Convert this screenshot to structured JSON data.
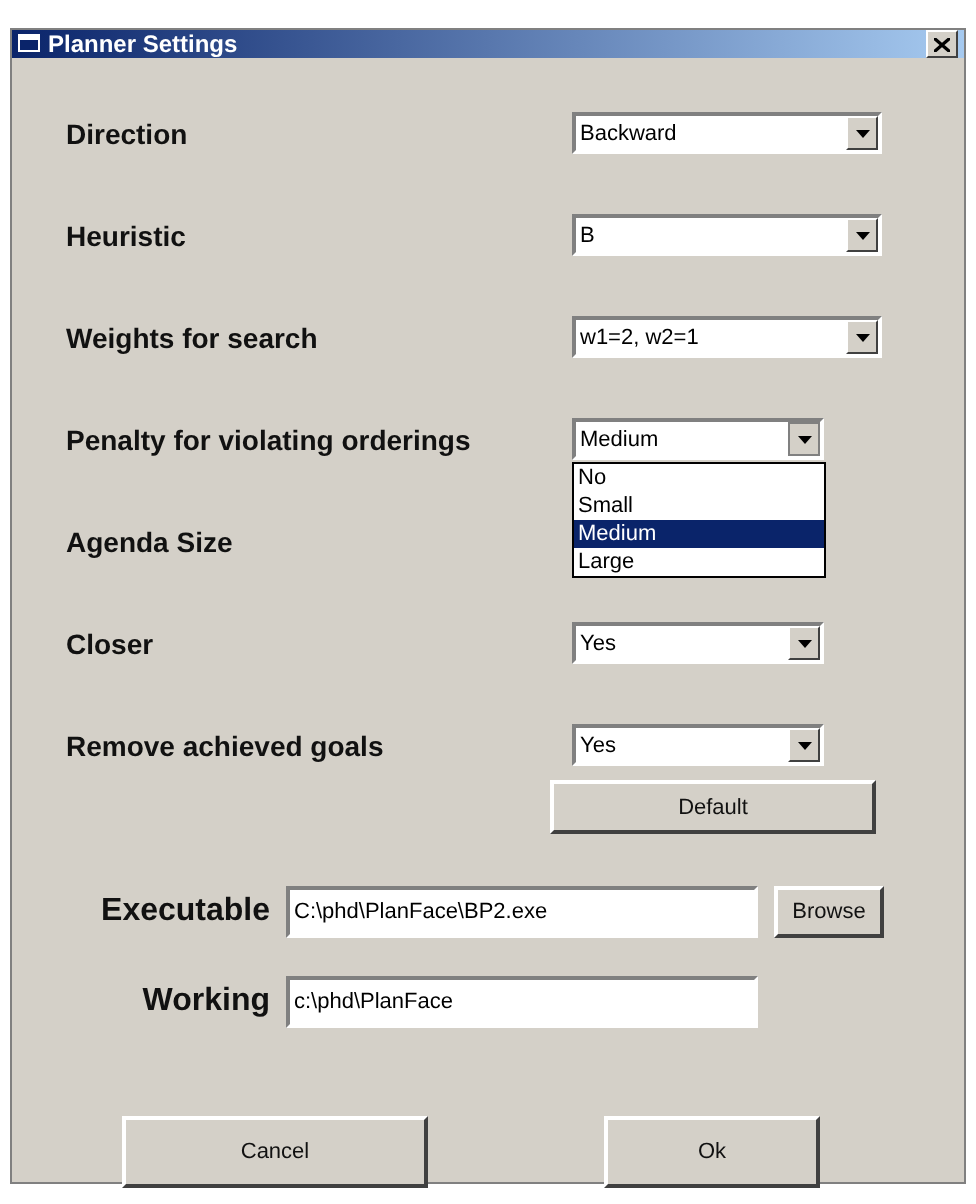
{
  "window": {
    "title": "Planner Settings"
  },
  "settings": [
    {
      "label": "Direction",
      "value": "Backward"
    },
    {
      "label": "Heuristic",
      "value": "B"
    },
    {
      "label": "Weights for search",
      "value": "w1=2, w2=1"
    },
    {
      "label": "Penalty for violating orderings",
      "value": "Medium",
      "expanded": true,
      "options": [
        {
          "label": "No",
          "selected": false
        },
        {
          "label": "Small",
          "selected": false
        },
        {
          "label": "Medium",
          "selected": true
        },
        {
          "label": "Large",
          "selected": false
        }
      ]
    },
    {
      "label": "Agenda Size"
    },
    {
      "label": "Closer",
      "value": "Yes"
    },
    {
      "label": "Remove achieved goals",
      "value": "Yes"
    }
  ],
  "default_button": "Default",
  "paths": [
    {
      "label": "Executable",
      "value": "C:\\phd\\PlanFace\\BP2.exe",
      "button": "Browse"
    },
    {
      "label": "Working",
      "value": "c:\\phd\\PlanFace"
    }
  ],
  "buttons": [
    "Cancel",
    "Ok"
  ]
}
